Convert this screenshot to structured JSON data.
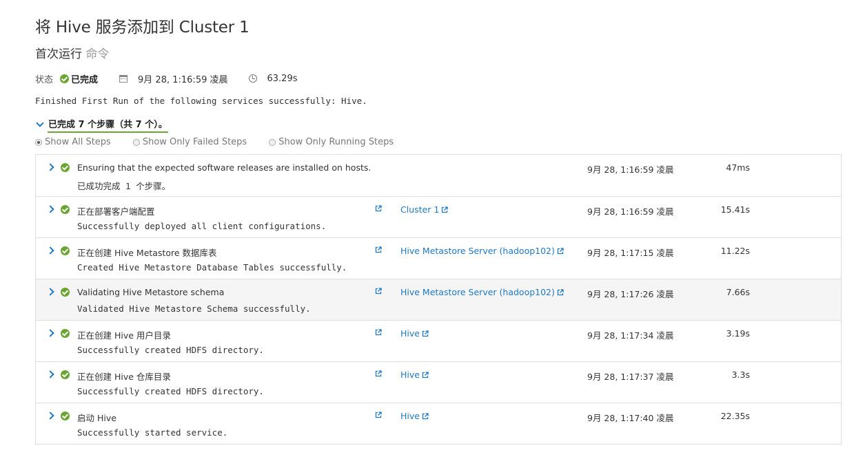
{
  "header": {
    "title": "将 Hive 服务添加到 Cluster 1",
    "subtitle_main": "首次运行",
    "subtitle_muted": "命令"
  },
  "status": {
    "label": "状态",
    "value": "已完成",
    "icon": "check-circle-icon",
    "datetime": "9月 28, 1:16:59 凌晨",
    "duration": "63.29s"
  },
  "message": "Finished First Run of the following services successfully: Hive.",
  "steps_summary": "已完成 7 个步骤（共 7 个）。",
  "filters": [
    {
      "label": "Show All Steps",
      "selected": true
    },
    {
      "label": "Show Only Failed Steps",
      "selected": false
    },
    {
      "label": "Show Only Running Steps",
      "selected": false
    }
  ],
  "steps": [
    {
      "title": "Ensuring that the expected software releases are installed on hosts.",
      "message": "已成功完成 1 个步骤。",
      "link": "",
      "time": "9月 28, 1:16:59 凌晨",
      "duration": "47ms"
    },
    {
      "title": "正在部署客户端配置",
      "message": "Successfully deployed all client configurations.",
      "link": "Cluster 1",
      "time": "9月 28, 1:16:59 凌晨",
      "duration": "15.41s"
    },
    {
      "title": "正在创建 Hive Metastore 数据库表",
      "message": "Created Hive Metastore Database Tables successfully.",
      "link": "Hive Metastore Server (hadoop102)",
      "time": "9月 28, 1:17:15 凌晨",
      "duration": "11.22s"
    },
    {
      "title": "Validating Hive Metastore schema",
      "message": "Validated Hive Metastore Schema successfully.",
      "link": "Hive Metastore Server (hadoop102)",
      "time": "9月 28, 1:17:26 凌晨",
      "duration": "7.66s"
    },
    {
      "title": "正在创建 Hive 用户目录",
      "message": "Successfully created HDFS directory.",
      "link": "Hive",
      "time": "9月 28, 1:17:34 凌晨",
      "duration": "3.19s"
    },
    {
      "title": "正在创建 Hive 仓库目录",
      "message": "Successfully created HDFS directory.",
      "link": "Hive",
      "time": "9月 28, 1:17:37 凌晨",
      "duration": "3.3s"
    },
    {
      "title": "启动 Hive",
      "message": "Successfully started service.",
      "link": "Hive",
      "time": "9月 28, 1:17:40 凌晨",
      "duration": "22.35s"
    }
  ],
  "colors": {
    "accent": "#1e78c2",
    "success": "#6aa531"
  }
}
